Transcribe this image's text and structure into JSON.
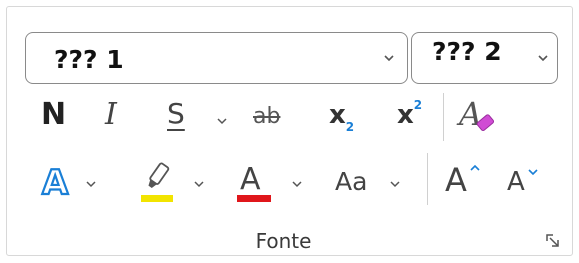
{
  "font_group": {
    "label": "Fonte",
    "font_name_value": "??? 1",
    "font_size_value": "??? 2",
    "bold_label": "N",
    "italic_label": "I",
    "underline_label": "S",
    "strikethrough_label": "ab",
    "subscript_label": "x",
    "subscript_index": "2",
    "superscript_label": "x",
    "superscript_index": "2",
    "change_case_label": "Aa",
    "grow_font_label": "A",
    "shrink_font_label": "A",
    "highlight_color": "#f2e400",
    "font_color": "#e0161b",
    "accent_color": "#1a7fd6",
    "icons": [
      "clear-formatting-icon",
      "text-effects-icon",
      "highlighter-icon",
      "font-color-icon",
      "dialog-launcher-icon"
    ]
  }
}
